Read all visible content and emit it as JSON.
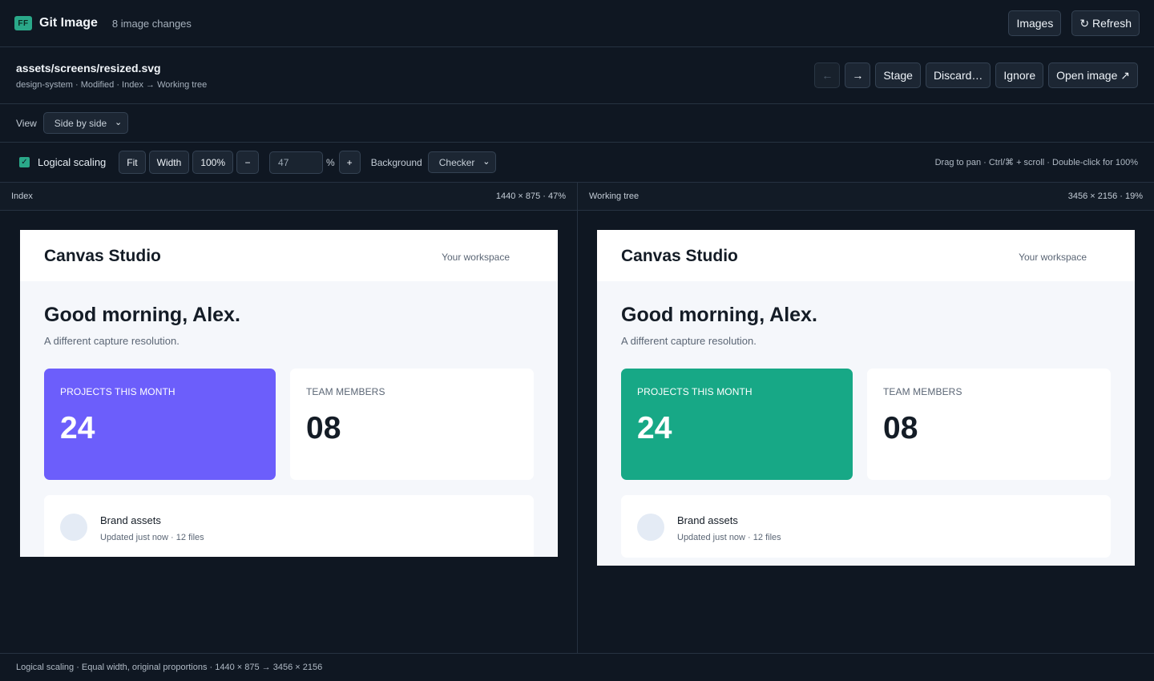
{
  "app": {
    "logo_text": "FF",
    "title": "Git Image",
    "changes": "8 image changes",
    "buttons": {
      "images": "Images",
      "refresh": "↻ Refresh"
    }
  },
  "file": {
    "path": "assets/screens/resized.svg",
    "meta": "design-system · Modified · Index → Working tree",
    "actions": {
      "prev": "←",
      "next": "→",
      "stage": "Stage",
      "discard": "Discard…",
      "ignore": "Ignore",
      "open": "Open image ↗"
    }
  },
  "view": {
    "label": "View",
    "selected": "Side by side"
  },
  "scaling": {
    "checkbox_label": "Logical scaling",
    "checked": true,
    "fit": "Fit",
    "width": "Width",
    "hundred": "100%",
    "minus": "−",
    "zoom_value": "47",
    "percent_sign": "%",
    "plus": "+",
    "background_label": "Background",
    "background_selected": "Checker",
    "hint": "Drag to pan · Ctrl/⌘ + scroll · Double-click for 100%"
  },
  "panes": [
    {
      "title": "Index",
      "info": "1440 × 875 · 47%",
      "shot": {
        "brand": "Canvas Studio",
        "workspace": "Your workspace",
        "greeting": "Good morning, Alex.",
        "subtitle": "A different capture resolution.",
        "card1_label": "PROJECTS THIS MONTH",
        "card1_value": "24",
        "card1_color": "#6c5efb",
        "card2_label": "TEAM MEMBERS",
        "card2_value": "08",
        "asset_title": "Brand assets",
        "asset_meta": "Updated just now · 12 files"
      }
    },
    {
      "title": "Working tree",
      "info": "3456 × 2156 · 19%",
      "shot": {
        "brand": "Canvas Studio",
        "workspace": "Your workspace",
        "greeting": "Good morning, Alex.",
        "subtitle": "A different capture resolution.",
        "card1_label": "PROJECTS THIS MONTH",
        "card1_value": "24",
        "card1_color": "#17a886",
        "card2_label": "TEAM MEMBERS",
        "card2_value": "08",
        "asset_title": "Brand assets",
        "asset_meta": "Updated just now · 12 files"
      }
    }
  ],
  "status": "Logical scaling · Equal width, original proportions · 1440 × 875 → 3456 × 2156"
}
